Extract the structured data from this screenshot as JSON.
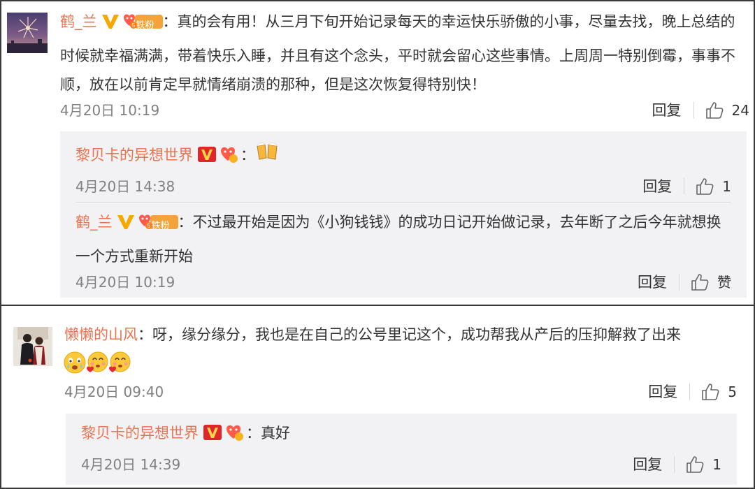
{
  "comments": [
    {
      "author": "鹤_兰",
      "fan_badge": "铁粉",
      "separator": "：",
      "text": "真的会有用！从三月下旬开始记录每天的幸运快乐骄傲的小事，尽量去找，晚上总结的时候就幸福满满，带着快乐入睡，并且有这个念头，平时就会留心这些事情。上周周一特别倒霉，事事不顺，放在以前肯定早就情绪崩溃的那种，但是这次恢复得特别快！",
      "time": "4月20日 10:19",
      "reply_label": "回复",
      "likes": "24",
      "replies": [
        {
          "author": "黎贝卡的异想世界",
          "separator": "：",
          "text": "",
          "emoji": "beers-emoji",
          "time": "4月20日 14:38",
          "reply_label": "回复",
          "likes": "1"
        },
        {
          "author": "鹤_兰",
          "fan_badge": "铁粉",
          "separator": "：",
          "text": "不过最开始是因为《小狗钱钱》的成功日记开始做记录，去年断了之后今年就想换一个方式重新开始",
          "time": "4月20日 10:19",
          "reply_label": "回复",
          "likes": "赞"
        }
      ]
    },
    {
      "author": "懒懒的山风",
      "separator": "：",
      "text": "呀，缘分缘分，我也是在自己的公号里记这个，成功帮我从产后的压抑解救了出来",
      "emojis": [
        "tearful-emoji",
        "love-emoji",
        "love-emoji"
      ],
      "time": "4月20日 09:40",
      "reply_label": "回复",
      "likes": "5",
      "replies": [
        {
          "author": "黎贝卡的异想世界",
          "separator": "：",
          "text": "真好",
          "time": "4月20日 14:39",
          "reply_label": "回复",
          "likes": "1"
        }
      ]
    }
  ],
  "colors": {
    "username": "#eb7350",
    "text": "#333333",
    "meta": "#808080",
    "reply_bg": "#f2f2f5",
    "verified_badge": "#f7a800",
    "fan_badge": "#f3a33a"
  }
}
